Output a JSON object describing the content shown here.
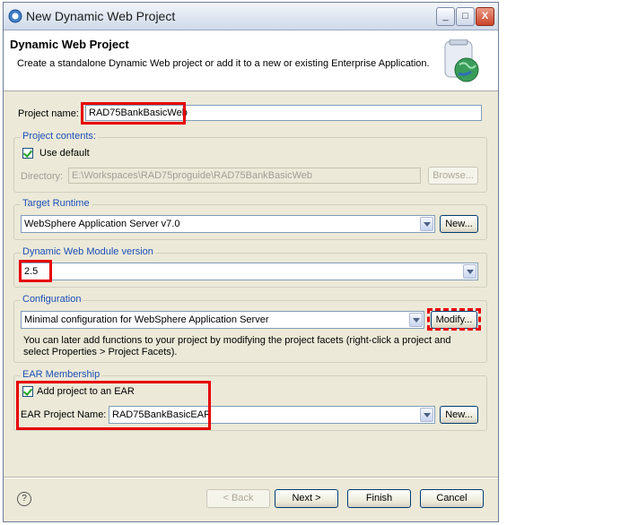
{
  "window": {
    "title": "New Dynamic Web Project",
    "minimize": "_",
    "maximize": "□",
    "close": "X"
  },
  "header": {
    "title": "Dynamic Web Project",
    "description": "Create a standalone Dynamic Web project or add it to a new or existing Enterprise Application."
  },
  "project_name": {
    "label": "Project name:",
    "value": "RAD75BankBasicWeb"
  },
  "project_contents": {
    "legend": "Project contents:",
    "use_default_label": "Use default",
    "use_default_checked": true,
    "directory_label": "Directory:",
    "directory_value": "E:\\Workspaces\\RAD75proguide\\RAD75BankBasicWeb",
    "browse_label": "Browse..."
  },
  "target_runtime": {
    "legend": "Target Runtime",
    "value": "WebSphere Application Server v7.0",
    "new_label": "New..."
  },
  "module_version": {
    "legend": "Dynamic Web Module version",
    "value": "2.5"
  },
  "configuration": {
    "legend": "Configuration",
    "value": "Minimal configuration for WebSphere Application Server",
    "modify_label": "Modify...",
    "note_line1": "You can later add functions to your project by modifying the project facets (right-click a project and",
    "note_line2": "select Properties > Project Facets)."
  },
  "ear": {
    "legend": "EAR Membership",
    "add_label": "Add project to an EAR",
    "add_checked": true,
    "name_label": "EAR Project Name:",
    "name_value": "RAD75BankBasicEAR",
    "new_label": "New..."
  },
  "footer": {
    "help": "?",
    "back_label": "< Back",
    "next_label": "Next >",
    "finish_label": "Finish",
    "cancel_label": "Cancel"
  },
  "colors": {
    "annotation_red": "#e60000",
    "group_label_blue": "#1b4fb8"
  }
}
